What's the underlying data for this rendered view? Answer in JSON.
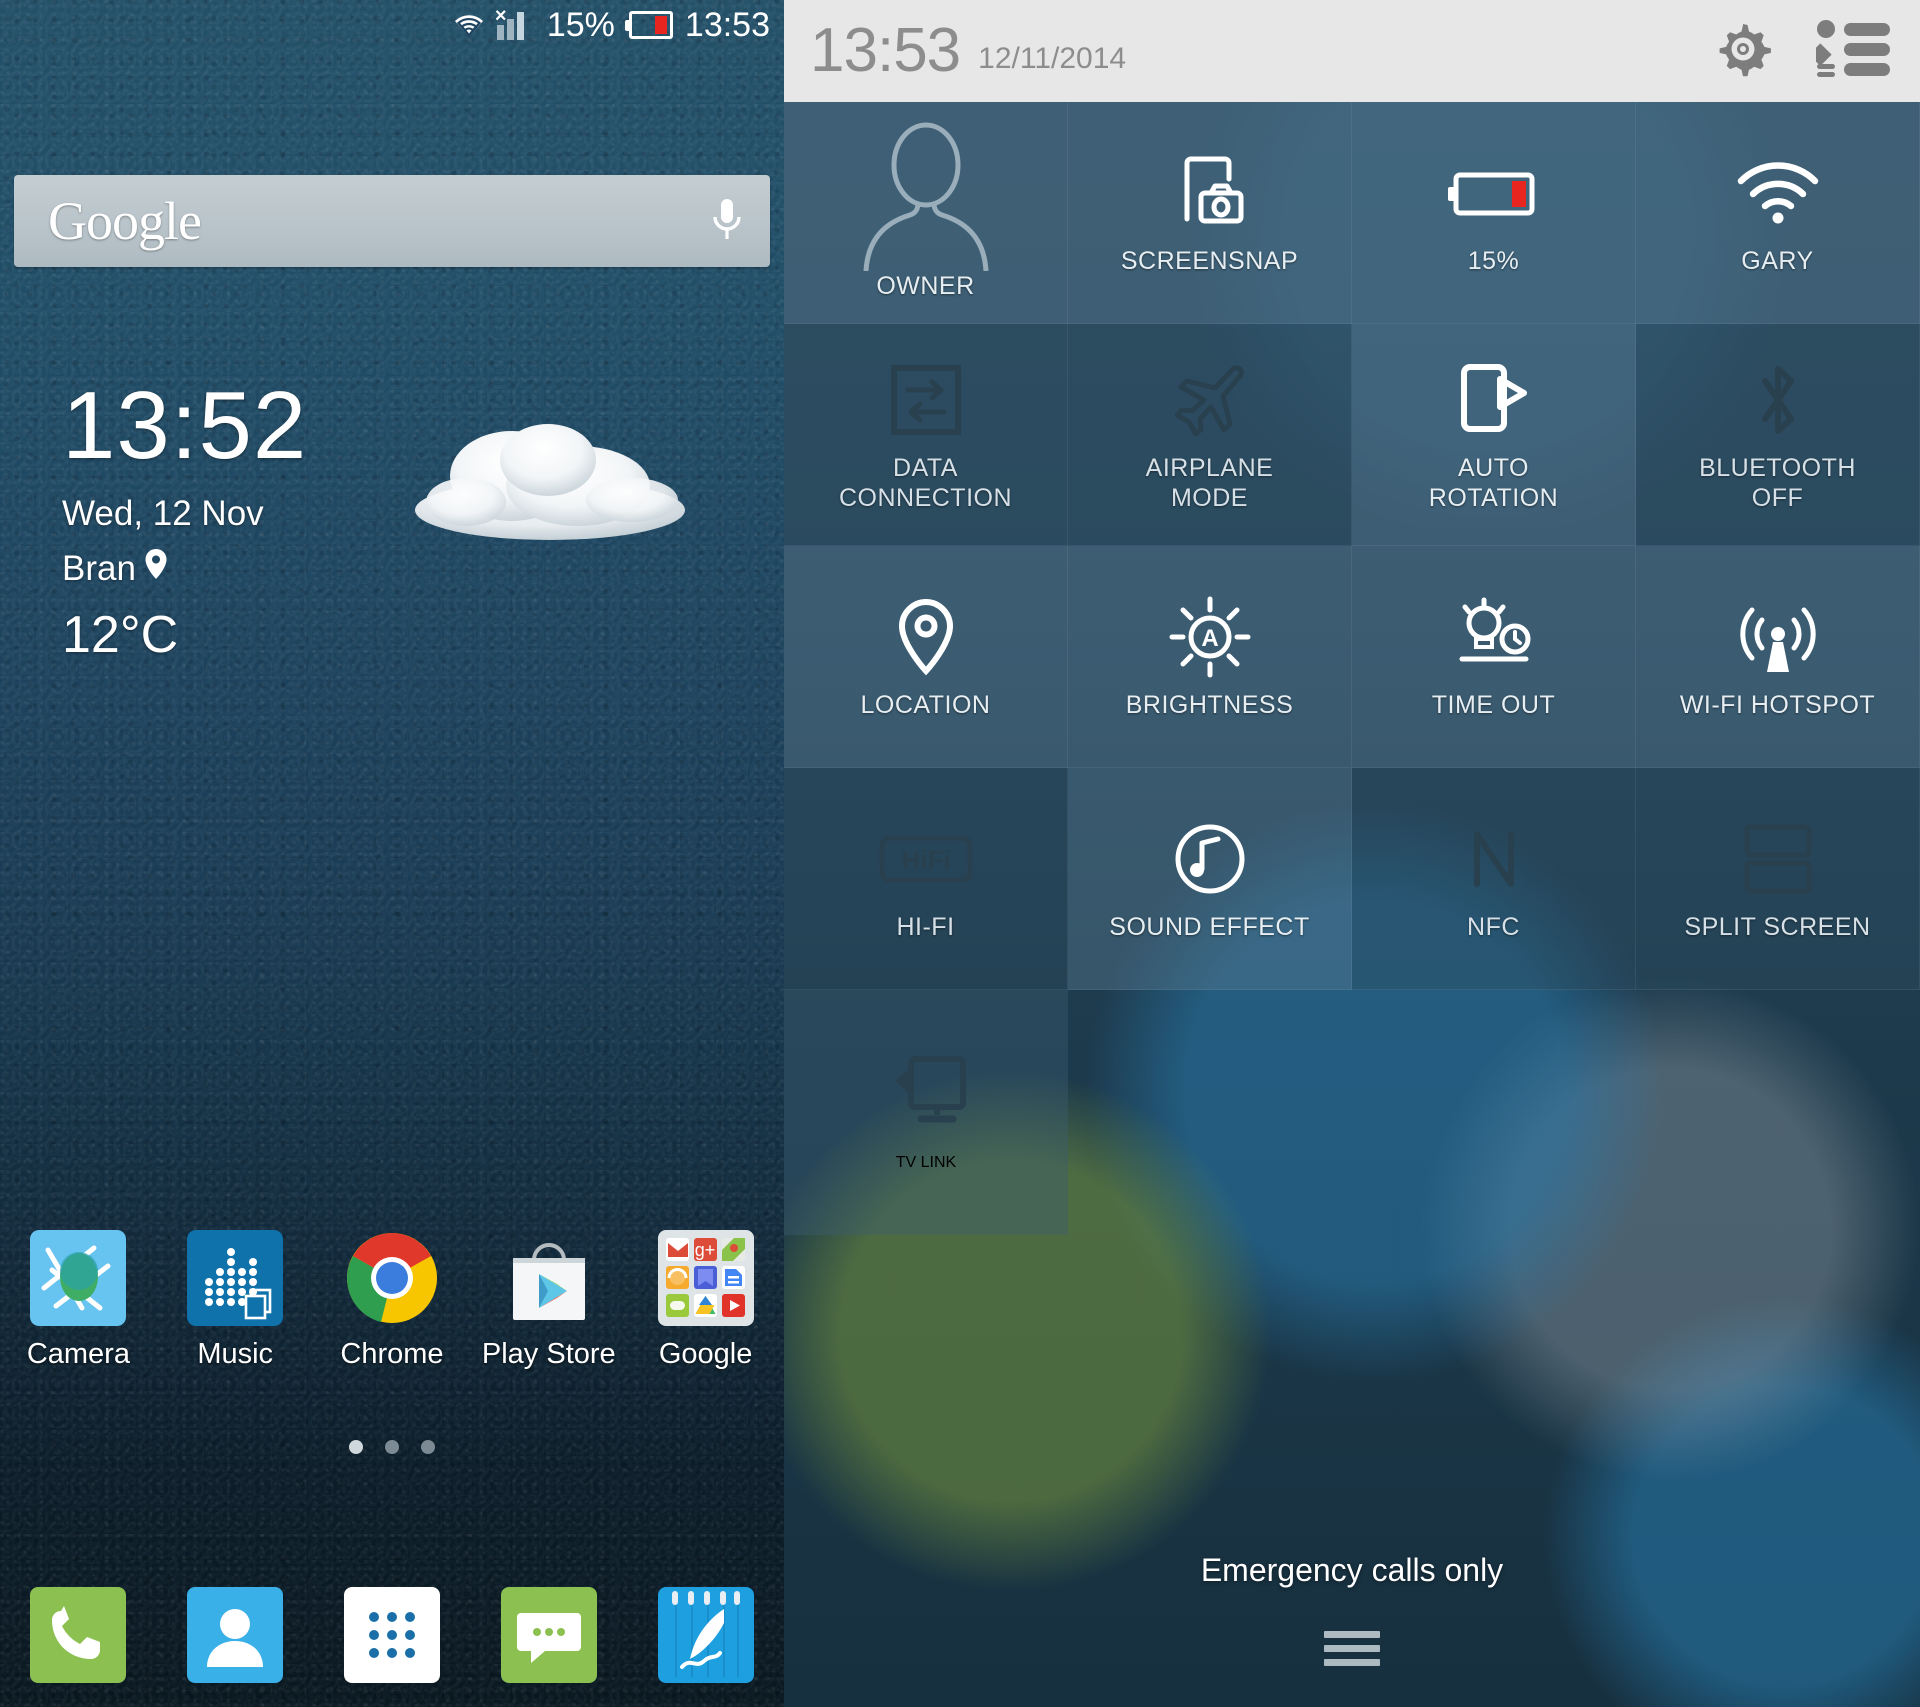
{
  "home": {
    "status_bar": {
      "wifi_icon": "wifi-icon",
      "signal_icon": "signal-bars-icon",
      "no_sim_icon": "x-mark-icon",
      "battery_percent": "15%",
      "battery_icon": "battery-low-icon",
      "time": "13:53"
    },
    "search": {
      "logo_text": "Google",
      "mic_icon": "microphone-icon",
      "placeholder": "Google"
    },
    "clock_widget": {
      "time": "13:52",
      "date": "Wed,  12 Nov",
      "location": "Bran",
      "location_icon": "map-pin-icon",
      "temperature": "12°C",
      "weather_icon": "cloud-icon"
    },
    "apps": [
      {
        "label": "Camera",
        "icon": "camera-app-icon"
      },
      {
        "label": "Music",
        "icon": "music-app-icon"
      },
      {
        "label": "Chrome",
        "icon": "chrome-app-icon"
      },
      {
        "label": "Play Store",
        "icon": "play-store-app-icon"
      },
      {
        "label": "Google",
        "icon": "google-folder-icon"
      }
    ],
    "page_indicator": {
      "count": 3,
      "active": 1
    },
    "dock": [
      {
        "name": "phone",
        "icon": "phone-icon"
      },
      {
        "name": "contacts",
        "icon": "contacts-icon"
      },
      {
        "name": "app-drawer",
        "icon": "app-drawer-icon"
      },
      {
        "name": "messages",
        "icon": "messages-icon"
      },
      {
        "name": "notes",
        "icon": "notes-icon"
      }
    ]
  },
  "shade": {
    "header": {
      "time": "13:53",
      "date": "12/11/2014",
      "settings_icon": "gear-icon",
      "list_icon": "notification-list-icon"
    },
    "tiles": [
      {
        "label": "OWNER",
        "icon": "user-avatar-icon",
        "state": "on"
      },
      {
        "label": "SCREENSNAP",
        "icon": "screenshot-icon",
        "state": "on"
      },
      {
        "label": "15%",
        "icon": "battery-low-icon",
        "state": "on"
      },
      {
        "label": "GARY",
        "icon": "wifi-icon",
        "state": "on"
      },
      {
        "label": "DATA\nCONNECTION",
        "icon": "data-transfer-icon",
        "state": "off"
      },
      {
        "label": "AIRPLANE\nMODE",
        "icon": "airplane-icon",
        "state": "off"
      },
      {
        "label": "AUTO\nROTATION",
        "icon": "auto-rotate-icon",
        "state": "on"
      },
      {
        "label": "BLUETOOTH\nOFF",
        "icon": "bluetooth-icon",
        "state": "off"
      },
      {
        "label": "LOCATION",
        "icon": "map-pin-icon",
        "state": "on"
      },
      {
        "label": "BRIGHTNESS",
        "icon": "brightness-auto-icon",
        "state": "on"
      },
      {
        "label": "TIME OUT",
        "icon": "screen-timeout-icon",
        "state": "on"
      },
      {
        "label": "WI-FI HOTSPOT",
        "icon": "hotspot-icon",
        "state": "on"
      },
      {
        "label": "HI-FI",
        "icon": "hifi-icon",
        "state": "off"
      },
      {
        "label": "SOUND EFFECT",
        "icon": "sound-effect-icon",
        "state": "on"
      },
      {
        "label": "NFC",
        "icon": "nfc-icon",
        "state": "off"
      },
      {
        "label": "SPLIT SCREEN",
        "icon": "split-screen-icon",
        "state": "off"
      }
    ],
    "tv_link": {
      "label": "TV LINK",
      "icon": "tv-cast-icon",
      "state": "off"
    },
    "footer": {
      "status": "Emergency calls only",
      "handle_icon": "drag-handle-icon"
    }
  },
  "colors": {
    "wallpaper": "#1f4560",
    "shade_header_bg": "#e7e7e7",
    "shade_header_text": "#8d8d8d",
    "battery_red": "#e8251f",
    "tile_label": "#e7eef2",
    "accent_white": "#ffffff"
  }
}
